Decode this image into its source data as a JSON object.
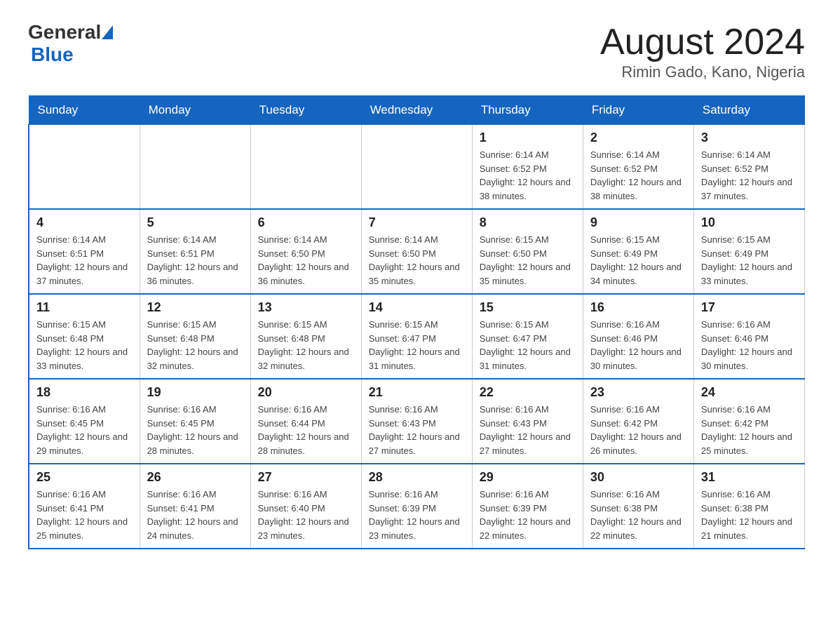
{
  "header": {
    "title": "August 2024",
    "subtitle": "Rimin Gado, Kano, Nigeria",
    "logo": {
      "general": "General",
      "blue": "Blue"
    }
  },
  "days_of_week": [
    "Sunday",
    "Monday",
    "Tuesday",
    "Wednesday",
    "Thursday",
    "Friday",
    "Saturday"
  ],
  "weeks": [
    [
      {
        "day": "",
        "info": ""
      },
      {
        "day": "",
        "info": ""
      },
      {
        "day": "",
        "info": ""
      },
      {
        "day": "",
        "info": ""
      },
      {
        "day": "1",
        "info": "Sunrise: 6:14 AM\nSunset: 6:52 PM\nDaylight: 12 hours and 38 minutes."
      },
      {
        "day": "2",
        "info": "Sunrise: 6:14 AM\nSunset: 6:52 PM\nDaylight: 12 hours and 38 minutes."
      },
      {
        "day": "3",
        "info": "Sunrise: 6:14 AM\nSunset: 6:52 PM\nDaylight: 12 hours and 37 minutes."
      }
    ],
    [
      {
        "day": "4",
        "info": "Sunrise: 6:14 AM\nSunset: 6:51 PM\nDaylight: 12 hours and 37 minutes."
      },
      {
        "day": "5",
        "info": "Sunrise: 6:14 AM\nSunset: 6:51 PM\nDaylight: 12 hours and 36 minutes."
      },
      {
        "day": "6",
        "info": "Sunrise: 6:14 AM\nSunset: 6:50 PM\nDaylight: 12 hours and 36 minutes."
      },
      {
        "day": "7",
        "info": "Sunrise: 6:14 AM\nSunset: 6:50 PM\nDaylight: 12 hours and 35 minutes."
      },
      {
        "day": "8",
        "info": "Sunrise: 6:15 AM\nSunset: 6:50 PM\nDaylight: 12 hours and 35 minutes."
      },
      {
        "day": "9",
        "info": "Sunrise: 6:15 AM\nSunset: 6:49 PM\nDaylight: 12 hours and 34 minutes."
      },
      {
        "day": "10",
        "info": "Sunrise: 6:15 AM\nSunset: 6:49 PM\nDaylight: 12 hours and 33 minutes."
      }
    ],
    [
      {
        "day": "11",
        "info": "Sunrise: 6:15 AM\nSunset: 6:48 PM\nDaylight: 12 hours and 33 minutes."
      },
      {
        "day": "12",
        "info": "Sunrise: 6:15 AM\nSunset: 6:48 PM\nDaylight: 12 hours and 32 minutes."
      },
      {
        "day": "13",
        "info": "Sunrise: 6:15 AM\nSunset: 6:48 PM\nDaylight: 12 hours and 32 minutes."
      },
      {
        "day": "14",
        "info": "Sunrise: 6:15 AM\nSunset: 6:47 PM\nDaylight: 12 hours and 31 minutes."
      },
      {
        "day": "15",
        "info": "Sunrise: 6:15 AM\nSunset: 6:47 PM\nDaylight: 12 hours and 31 minutes."
      },
      {
        "day": "16",
        "info": "Sunrise: 6:16 AM\nSunset: 6:46 PM\nDaylight: 12 hours and 30 minutes."
      },
      {
        "day": "17",
        "info": "Sunrise: 6:16 AM\nSunset: 6:46 PM\nDaylight: 12 hours and 30 minutes."
      }
    ],
    [
      {
        "day": "18",
        "info": "Sunrise: 6:16 AM\nSunset: 6:45 PM\nDaylight: 12 hours and 29 minutes."
      },
      {
        "day": "19",
        "info": "Sunrise: 6:16 AM\nSunset: 6:45 PM\nDaylight: 12 hours and 28 minutes."
      },
      {
        "day": "20",
        "info": "Sunrise: 6:16 AM\nSunset: 6:44 PM\nDaylight: 12 hours and 28 minutes."
      },
      {
        "day": "21",
        "info": "Sunrise: 6:16 AM\nSunset: 6:43 PM\nDaylight: 12 hours and 27 minutes."
      },
      {
        "day": "22",
        "info": "Sunrise: 6:16 AM\nSunset: 6:43 PM\nDaylight: 12 hours and 27 minutes."
      },
      {
        "day": "23",
        "info": "Sunrise: 6:16 AM\nSunset: 6:42 PM\nDaylight: 12 hours and 26 minutes."
      },
      {
        "day": "24",
        "info": "Sunrise: 6:16 AM\nSunset: 6:42 PM\nDaylight: 12 hours and 25 minutes."
      }
    ],
    [
      {
        "day": "25",
        "info": "Sunrise: 6:16 AM\nSunset: 6:41 PM\nDaylight: 12 hours and 25 minutes."
      },
      {
        "day": "26",
        "info": "Sunrise: 6:16 AM\nSunset: 6:41 PM\nDaylight: 12 hours and 24 minutes."
      },
      {
        "day": "27",
        "info": "Sunrise: 6:16 AM\nSunset: 6:40 PM\nDaylight: 12 hours and 23 minutes."
      },
      {
        "day": "28",
        "info": "Sunrise: 6:16 AM\nSunset: 6:39 PM\nDaylight: 12 hours and 23 minutes."
      },
      {
        "day": "29",
        "info": "Sunrise: 6:16 AM\nSunset: 6:39 PM\nDaylight: 12 hours and 22 minutes."
      },
      {
        "day": "30",
        "info": "Sunrise: 6:16 AM\nSunset: 6:38 PM\nDaylight: 12 hours and 22 minutes."
      },
      {
        "day": "31",
        "info": "Sunrise: 6:16 AM\nSunset: 6:38 PM\nDaylight: 12 hours and 21 minutes."
      }
    ]
  ]
}
